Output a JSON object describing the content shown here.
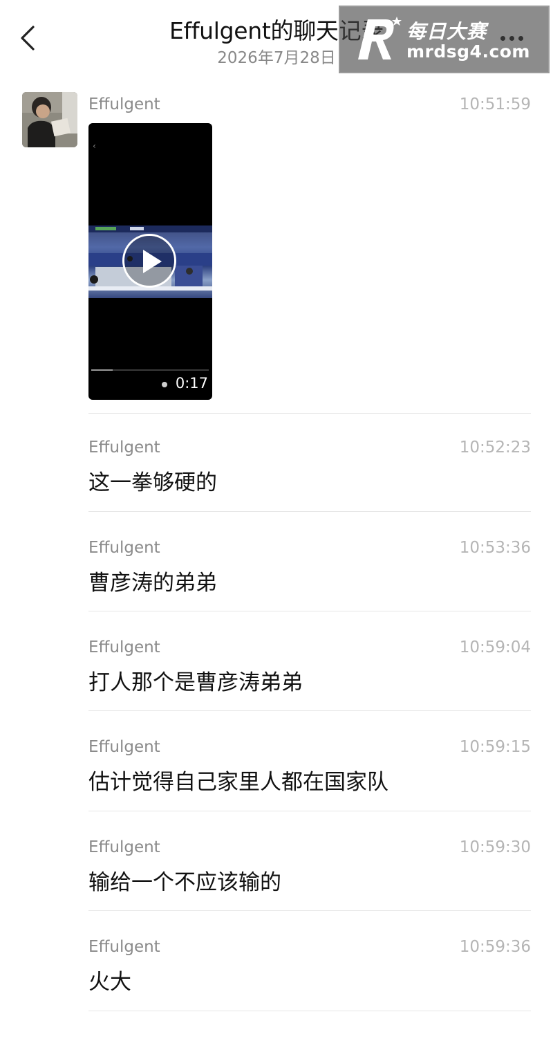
{
  "header": {
    "title": "Effulgent的聊天记录",
    "date": "2026年7月28日"
  },
  "watermark": {
    "name": "每日大赛",
    "url": "mrdsg4.com"
  },
  "icons": {
    "back": "chevron-left-icon",
    "more": "more-dots-icon",
    "play": "play-icon"
  },
  "video": {
    "duration": "0:17",
    "progress_fraction": 0.18
  },
  "messages": [
    {
      "sender": "Effulgent",
      "time": "10:51:59",
      "type": "video"
    },
    {
      "sender": "Effulgent",
      "time": "10:52:23",
      "text": "这一拳够硬的"
    },
    {
      "sender": "Effulgent",
      "time": "10:53:36",
      "text": "曹彦涛的弟弟"
    },
    {
      "sender": "Effulgent",
      "time": "10:59:04",
      "text": "打人那个是曹彦涛弟弟"
    },
    {
      "sender": "Effulgent",
      "time": "10:59:15",
      "text": "估计觉得自己家里人都在国家队"
    },
    {
      "sender": "Effulgent",
      "time": "10:59:30",
      "text": "输给一个不应该输的"
    },
    {
      "sender": "Effulgent",
      "time": "10:59:36",
      "text": "火大"
    }
  ]
}
